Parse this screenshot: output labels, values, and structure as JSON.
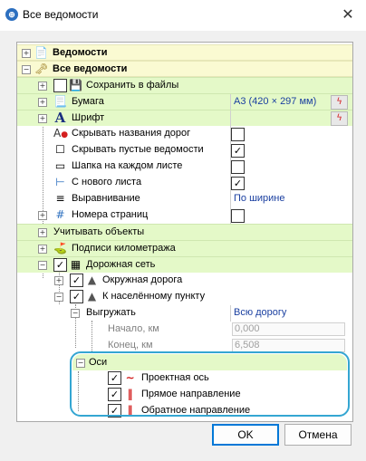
{
  "window": {
    "title": "Все ведомости",
    "close_glyph": "✕"
  },
  "tree": {
    "vedomosti": "Ведомости",
    "all": "Все ведомости",
    "save_files": "Сохранить в файлы",
    "paper": {
      "label": "Бумага",
      "value": "А3 (420 × 297 мм)"
    },
    "font": "Шрифт",
    "hide_roads": "Скрывать названия дорог",
    "hide_empty": "Скрывать пустые ведомости",
    "header_each": "Шапка на каждом листе",
    "new_sheet": "С нового листа",
    "align": {
      "label": "Выравнивание",
      "value": "По ширине"
    },
    "page_numbers": "Номера страниц",
    "objects": "Учитывать объекты",
    "km_labels": "Подписи километража",
    "road_net": "Дорожная сеть",
    "ring_road": "Окружная дорога",
    "to_place": "К населённому пункту",
    "export": {
      "label": "Выгружать",
      "value": "Всю дорогу"
    },
    "start": {
      "label": "Начало, км",
      "value": "0,000"
    },
    "end": {
      "label": "Конец, км",
      "value": "6,508"
    },
    "axes": "Оси",
    "design_axis": "Проектная ось",
    "forward": "Прямое направление",
    "reverse": "Обратное направление"
  },
  "buttons": {
    "ok": "OK",
    "cancel": "Отмена"
  },
  "icons": {
    "bolt": "ϟ",
    "check": "✓",
    "plus": "+",
    "minus": "−"
  },
  "colors": {
    "accent": "#34a6d2",
    "value_text": "#1a3fa0",
    "highlight": "#e4f9c8",
    "section": "#fafad2"
  }
}
